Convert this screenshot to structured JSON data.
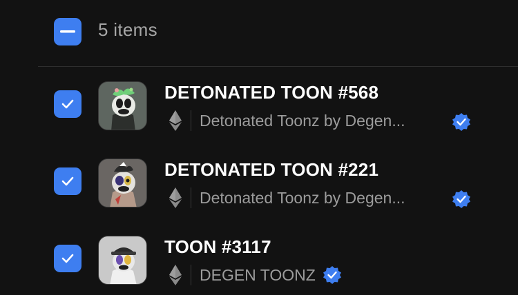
{
  "header": {
    "count_label": "5 items"
  },
  "items": [
    {
      "title": "DETONATED TOON #568",
      "collection": "Detonated Toonz by Degen...",
      "verified": true,
      "selected": true,
      "chain_icon": "ethereum-icon"
    },
    {
      "title": "DETONATED TOON #221",
      "collection": "Detonated Toonz by Degen...",
      "verified": true,
      "selected": true,
      "chain_icon": "ethereum-icon"
    },
    {
      "title": "TOON #3117",
      "collection": "DEGEN TOONZ",
      "verified": true,
      "selected": true,
      "chain_icon": "ethereum-icon"
    }
  ],
  "colors": {
    "accent": "#3e7ef0",
    "background": "#121212",
    "title": "#ffffff",
    "muted": "#9c9c9c"
  }
}
